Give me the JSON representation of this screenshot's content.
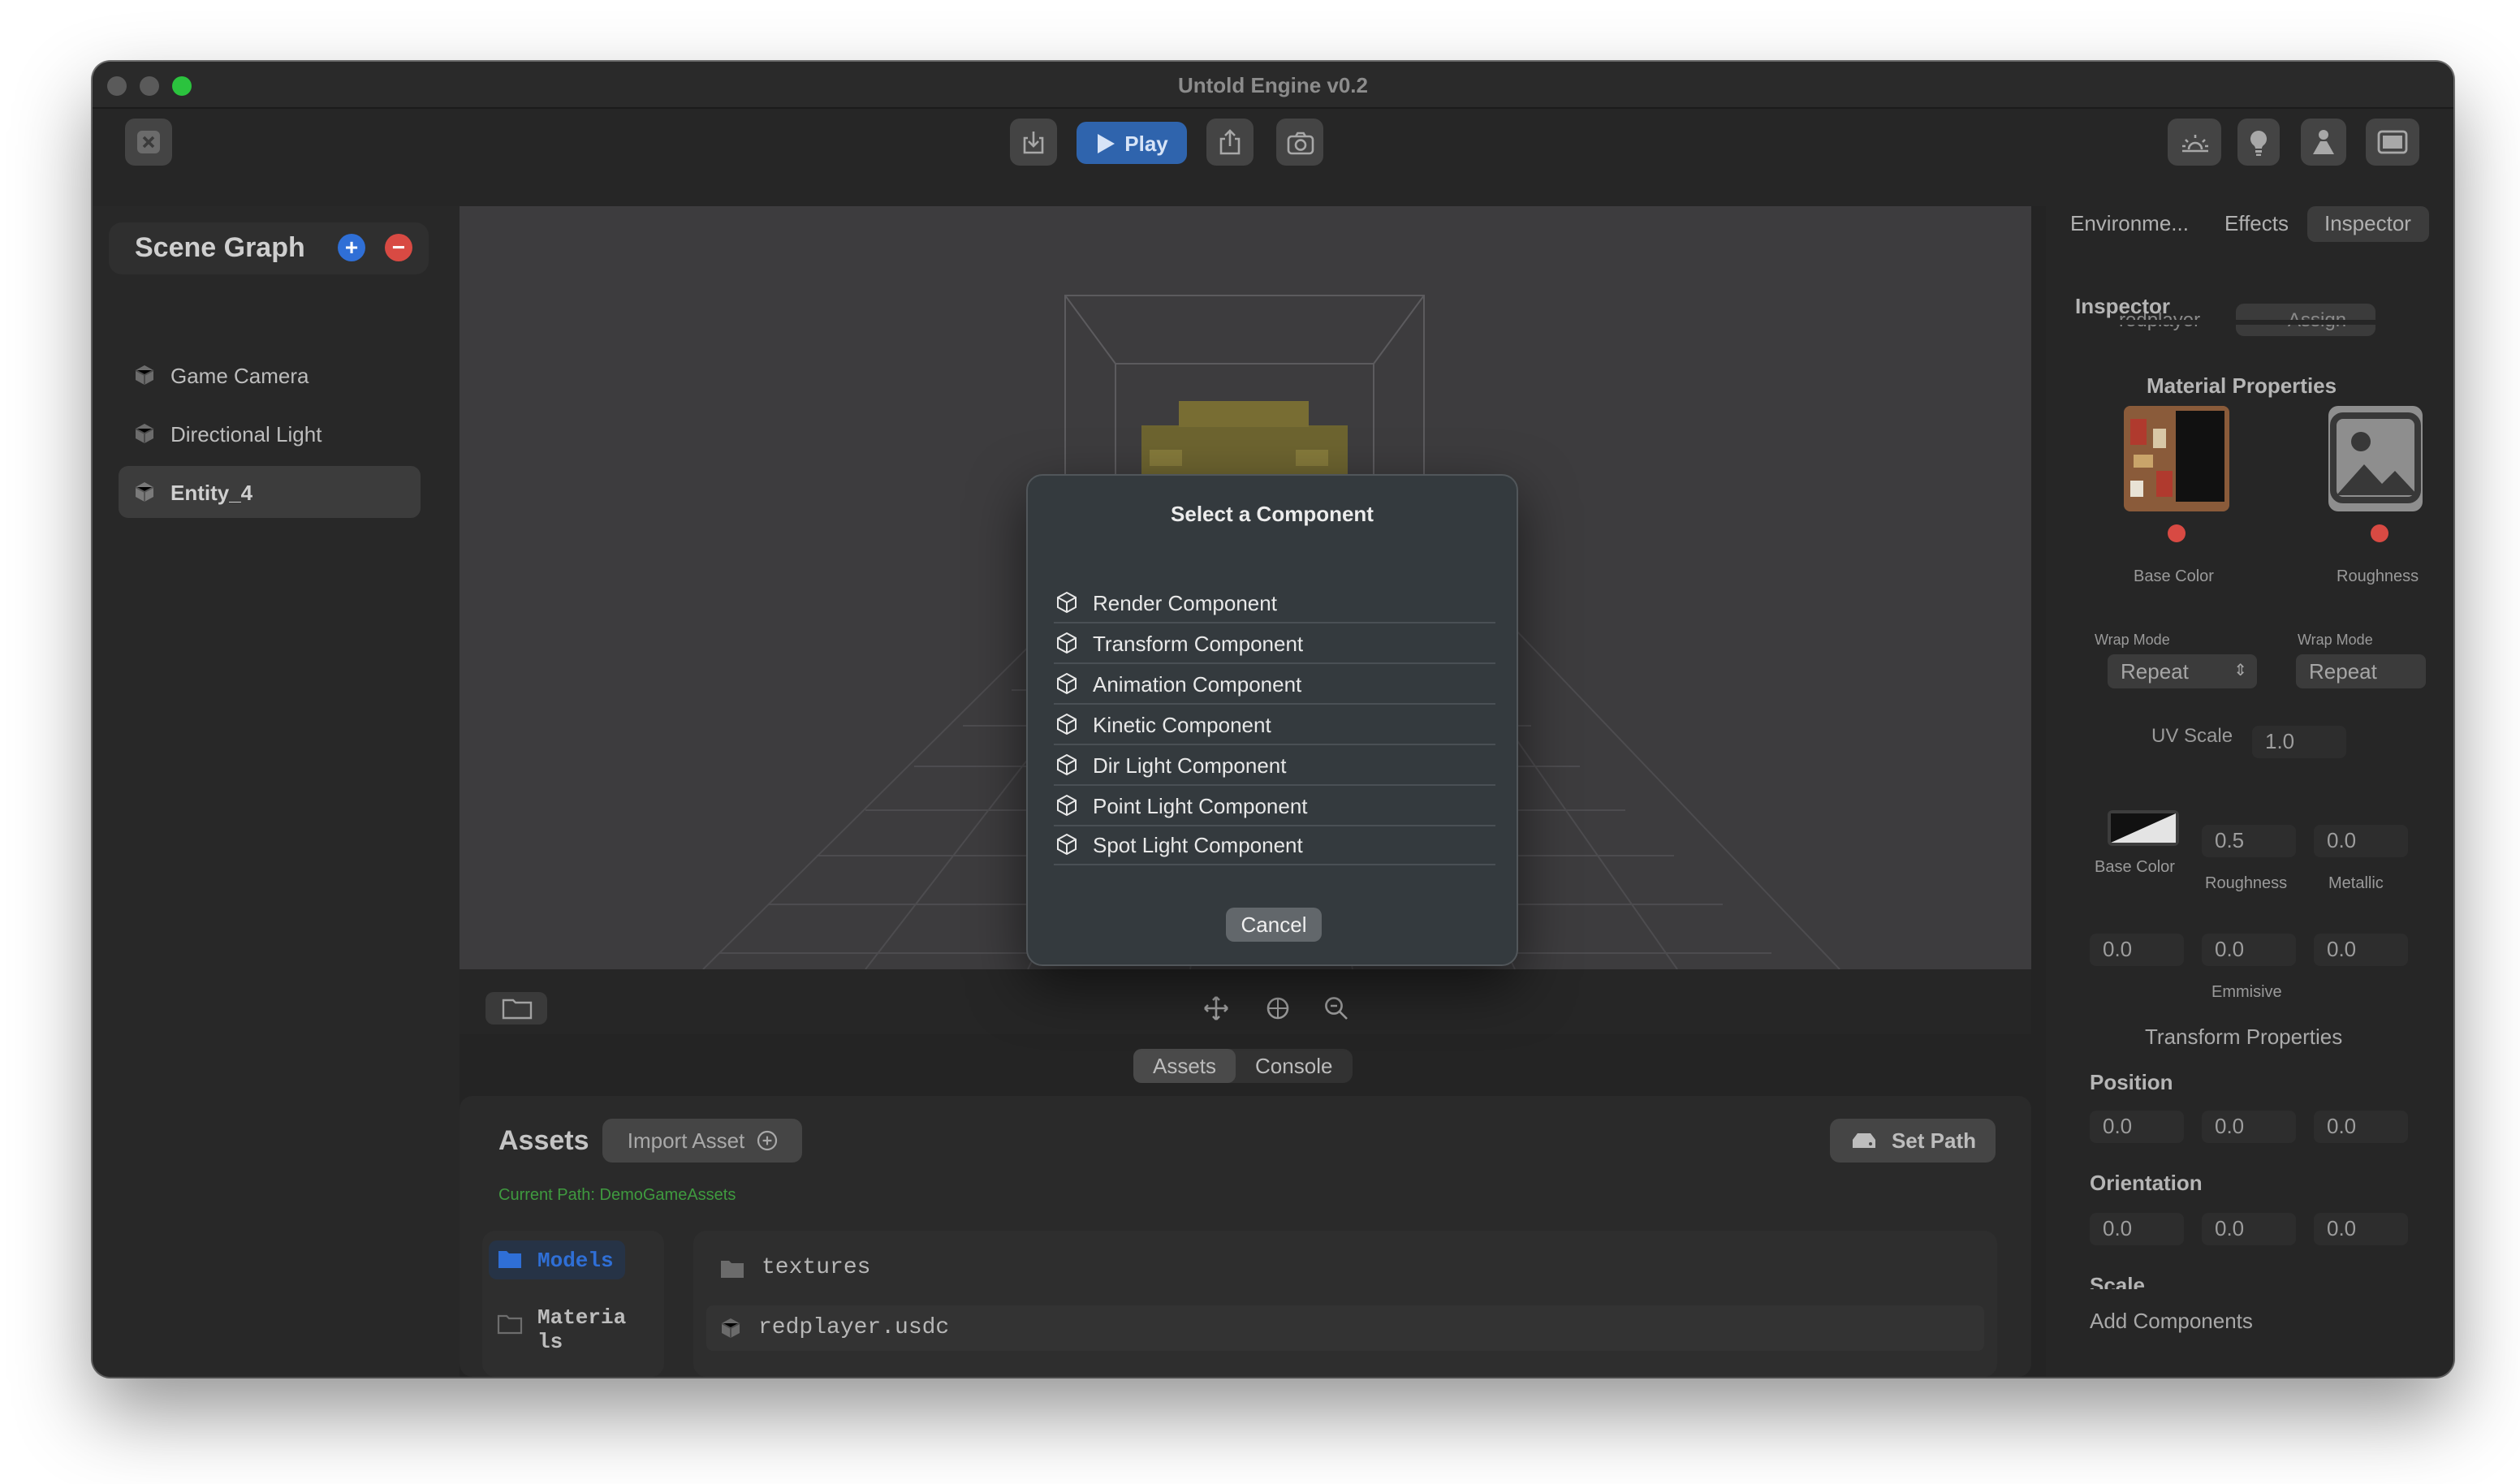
{
  "window": {
    "title": "Untold Engine v0.2"
  },
  "toolbar": {
    "play_label": "Play"
  },
  "scene_graph": {
    "title": "Scene Graph",
    "add_symbol": "+",
    "remove_symbol": "−",
    "items": [
      {
        "label": "Game Camera",
        "selected": false
      },
      {
        "label": "Directional Light",
        "selected": false
      },
      {
        "label": "Entity_4",
        "selected": true
      }
    ]
  },
  "bottom": {
    "tabs": [
      "Assets",
      "Console"
    ],
    "active_tab": "Assets",
    "assets_title": "Assets",
    "import_label": "Import Asset",
    "set_path_label": "Set Path",
    "current_path": "Current Path: DemoGameAssets",
    "folders": [
      {
        "label": "Models",
        "selected": true
      },
      {
        "label": "Materia\nls",
        "selected": false
      }
    ],
    "files": [
      {
        "name": "textures",
        "kind": "folder"
      },
      {
        "name": "redplayer.usdc",
        "kind": "model"
      }
    ]
  },
  "right_panel": {
    "tabs": [
      "Environme...",
      "Effects",
      "Inspector"
    ],
    "active_tab": "Inspector",
    "inspector_title": "Inspector",
    "assign_label": "Assign",
    "partial_label": "redplayer",
    "material_title": "Material Properties",
    "texture_slots": [
      {
        "label": "Base Color",
        "wrap_label": "Wrap Mode",
        "wrap_value": "Repeat"
      },
      {
        "label": "Roughness",
        "wrap_label": "Wrap Mode",
        "wrap_value": "Repeat"
      }
    ],
    "uv_scale_label": "UV Scale",
    "uv_scale_value": "1.0",
    "base_color_label": "Base Color",
    "roughness_label": "Roughness",
    "roughness_value": "0.5",
    "metallic_label": "Metallic",
    "metallic_value": "0.0",
    "emissive_label": "Emmisive",
    "emissive_values": [
      "0.0",
      "0.0",
      "0.0"
    ],
    "transform_title": "Transform Properties",
    "position_label": "Position",
    "position_values": [
      "0.0",
      "0.0",
      "0.0"
    ],
    "orientation_label": "Orientation",
    "orientation_values": [
      "0.0",
      "0.0",
      "0.0"
    ],
    "scale_label": "Scale",
    "add_components_label": "Add Components"
  },
  "dialog": {
    "title": "Select a Component",
    "items": [
      "Render Component",
      "Transform Component",
      "Animation Component",
      "Kinetic Component",
      "Dir Light Component",
      "Point Light Component",
      "Spot Light Component"
    ],
    "cancel_label": "Cancel"
  },
  "colors": {
    "accent_blue": "#2f64ad",
    "add_blue": "#2f6fd6",
    "remove_red": "#d84a43",
    "path_green": "#3f9a3f",
    "selection_blue": "#2f6fd6"
  }
}
